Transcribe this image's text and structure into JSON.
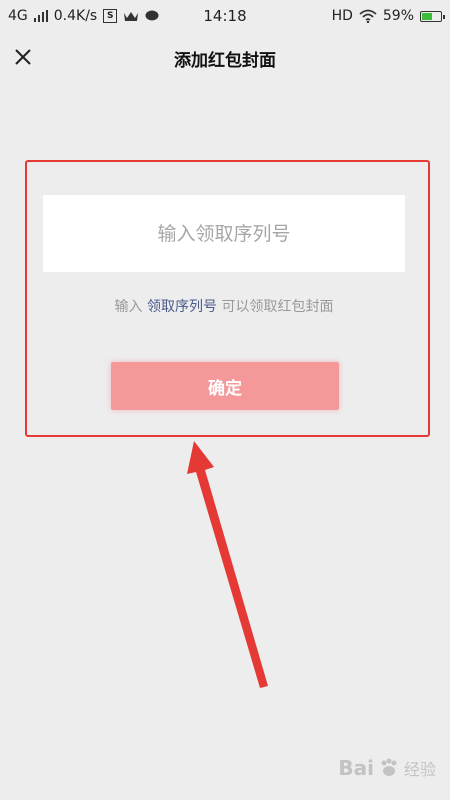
{
  "status_bar": {
    "network": "4G",
    "speed": "0.4K/s",
    "time": "14:18",
    "hd": "HD",
    "battery": "59%",
    "battery_level": 0.59
  },
  "header": {
    "title": "添加红包封面",
    "close_icon": "close-icon"
  },
  "form": {
    "serial_placeholder": "输入领取序列号",
    "serial_value": "",
    "hint_prefix": "输入",
    "hint_highlight": "领取序列号",
    "hint_suffix": "可以领取红包封面",
    "confirm_label": "确定"
  },
  "colors": {
    "annotation": "#e53935",
    "confirm_bg": "#f4989a",
    "link": "#4a5b8c",
    "page_bg": "#ededed"
  },
  "watermark": {
    "brand": "Bai",
    "suffix": "经验"
  }
}
